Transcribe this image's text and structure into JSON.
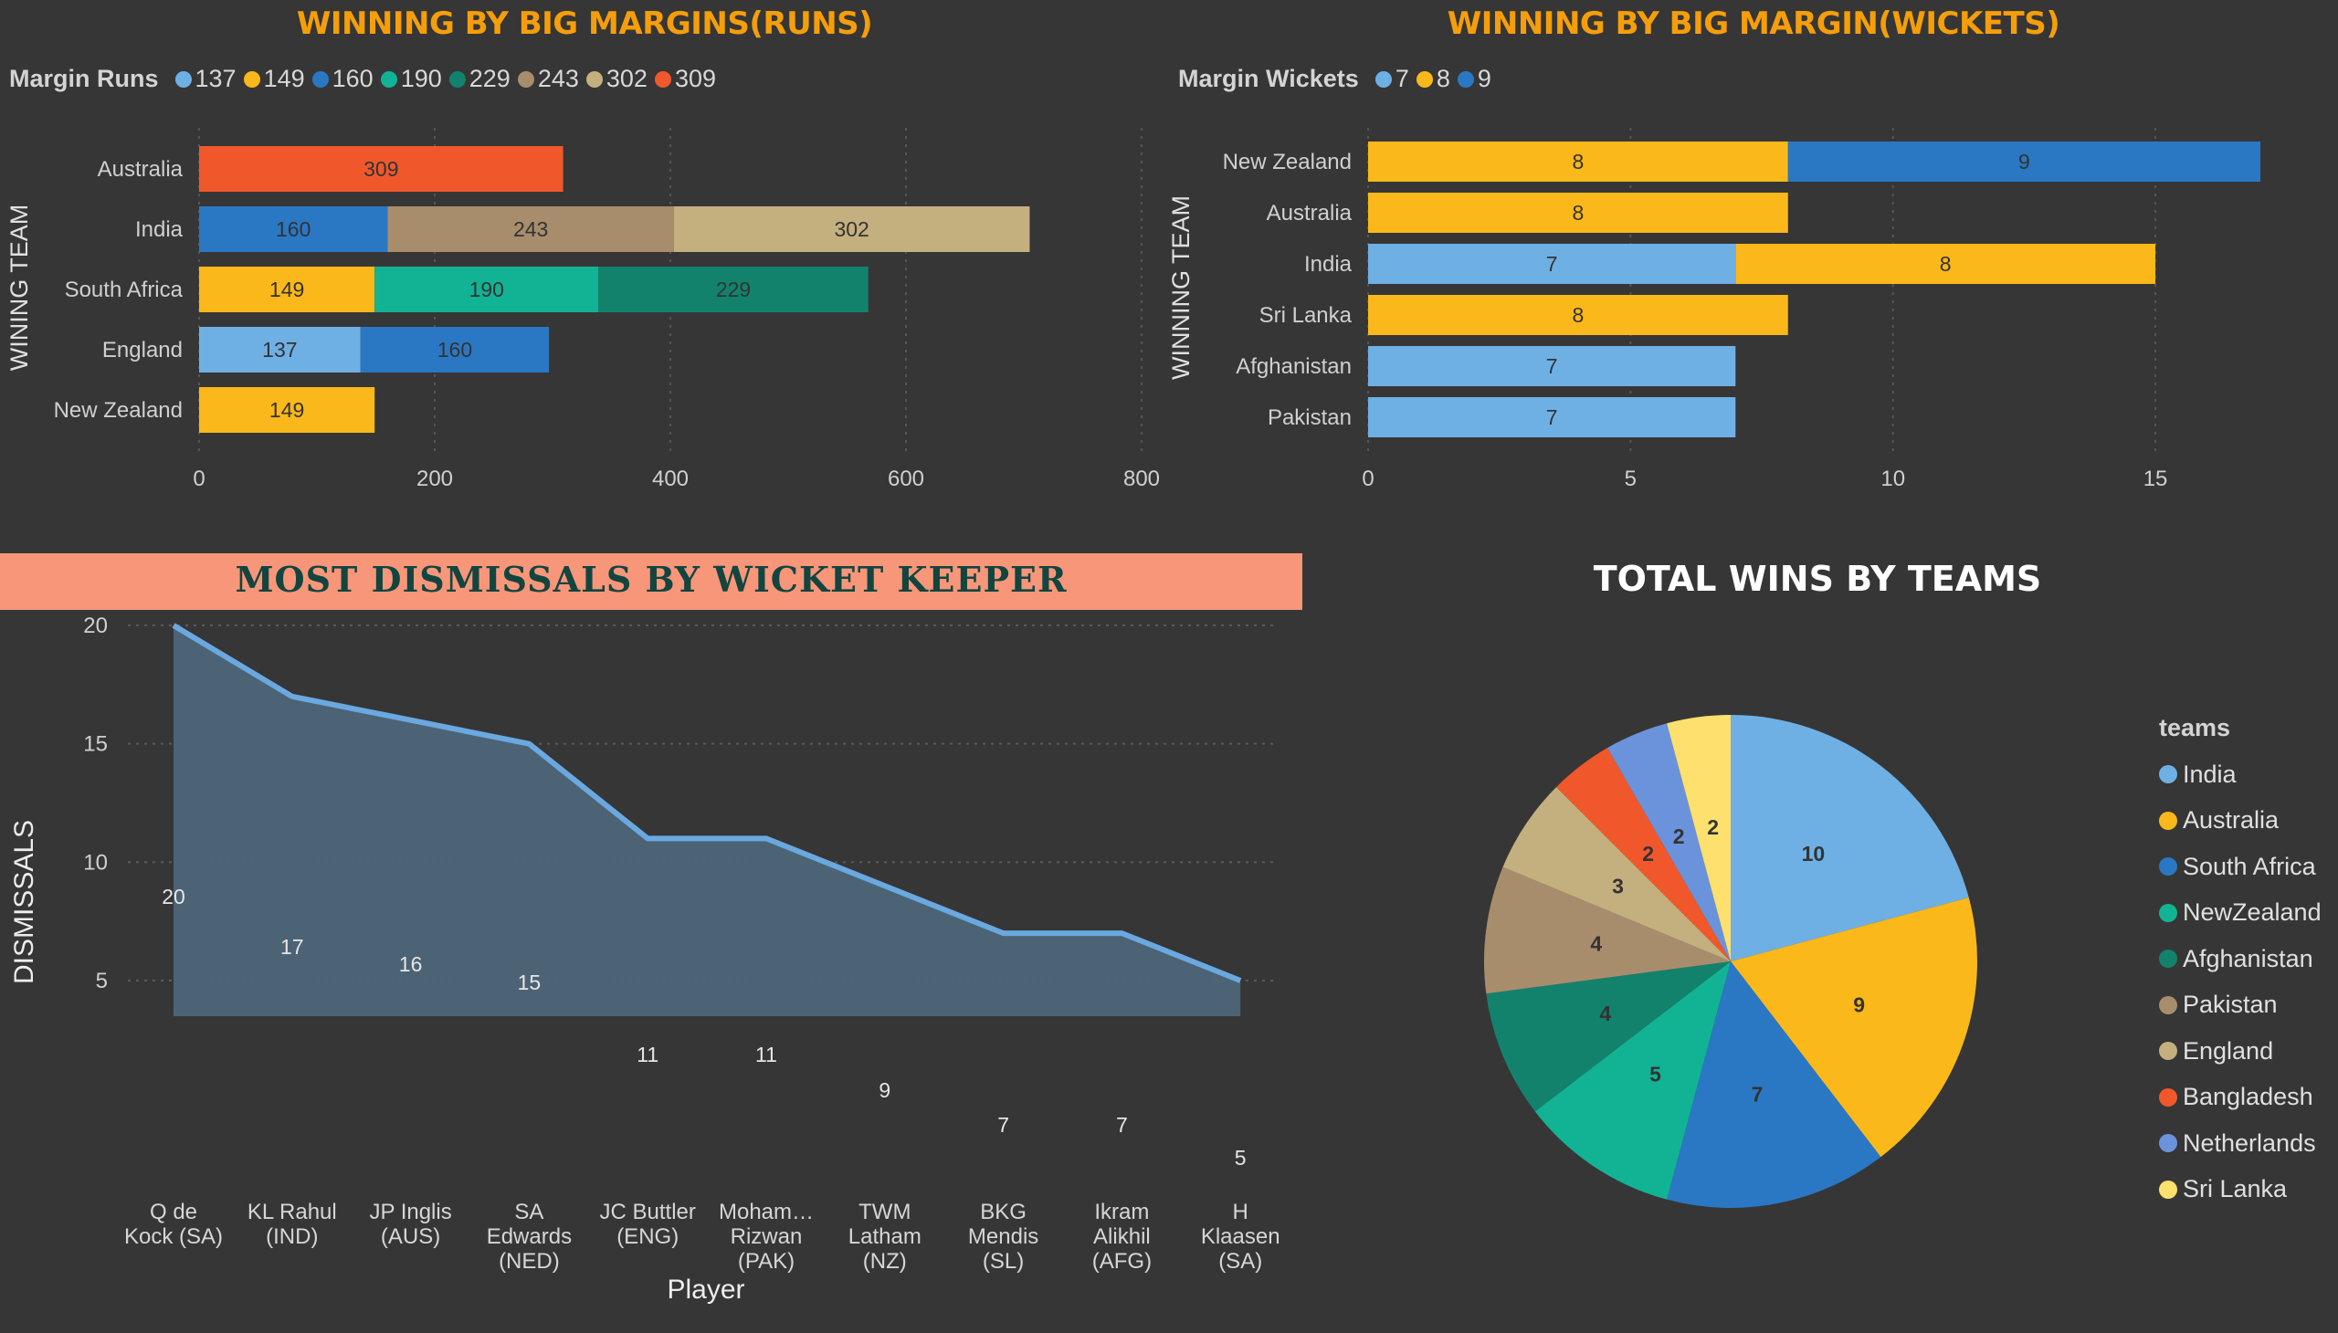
{
  "colors": {
    "background": "#363636",
    "title_orange": "#f59e0b",
    "wk_banner": "#f8967a",
    "wk_title": "#12453f",
    "area_line": "#6aa8e0",
    "area_fill": "#4e6679"
  },
  "runs_chart": {
    "title": "WINNING BY BIG MARGINS(RUNS)",
    "legend_title": "Margin Runs",
    "legend": [
      {
        "label": "137",
        "color": "#6eb0e4"
      },
      {
        "label": "149",
        "color": "#fbb81a"
      },
      {
        "label": "160",
        "color": "#2a78c3"
      },
      {
        "label": "190",
        "color": "#12b394"
      },
      {
        "label": "229",
        "color": "#12826d"
      },
      {
        "label": "243",
        "color": "#a88d6c"
      },
      {
        "label": "302",
        "color": "#c4b07f"
      },
      {
        "label": "309",
        "color": "#f0582c"
      }
    ],
    "y_axis_label": "WINING TEAM"
  },
  "wickets_chart": {
    "title": "WINNING BY BIG MARGIN(WICKETS)",
    "legend_title": "Margin Wickets",
    "legend": [
      {
        "label": "7",
        "color": "#6eb0e4"
      },
      {
        "label": "8",
        "color": "#fbb81a"
      },
      {
        "label": "9",
        "color": "#2a78c3"
      }
    ],
    "y_axis_label": "WINNING TEAM"
  },
  "wk_chart": {
    "title": "MOST DISMISSALS BY WICKET KEEPER",
    "x_axis_label": "Player",
    "y_axis_label": "DISMISSALS"
  },
  "pie_chart": {
    "title": "TOTAL WINS BY TEAMS",
    "legend_title": "teams"
  },
  "chart_data": [
    {
      "type": "bar",
      "stacked": true,
      "orientation": "horizontal",
      "title": "WINNING BY BIG MARGINS(RUNS)",
      "ylabel": "WINING TEAM",
      "xlim": [
        0,
        800
      ],
      "xticks": [
        0,
        200,
        400,
        600,
        800
      ],
      "grid": true,
      "legend_placement": "top-left",
      "categories": [
        "Australia",
        "India",
        "South Africa",
        "England",
        "New Zealand"
      ],
      "series": [
        {
          "name": "137",
          "values": [
            0,
            0,
            0,
            137,
            0
          ]
        },
        {
          "name": "149",
          "values": [
            0,
            0,
            149,
            0,
            149
          ]
        },
        {
          "name": "160",
          "values": [
            0,
            160,
            0,
            160,
            0
          ]
        },
        {
          "name": "190",
          "values": [
            0,
            0,
            190,
            0,
            0
          ]
        },
        {
          "name": "229",
          "values": [
            0,
            0,
            229,
            0,
            0
          ]
        },
        {
          "name": "243",
          "values": [
            0,
            243,
            0,
            0,
            0
          ]
        },
        {
          "name": "302",
          "values": [
            0,
            302,
            0,
            0,
            0
          ]
        },
        {
          "name": "309",
          "values": [
            309,
            0,
            0,
            0,
            0
          ]
        }
      ]
    },
    {
      "type": "bar",
      "stacked": true,
      "orientation": "horizontal",
      "title": "WINNING BY BIG MARGIN(WICKETS)",
      "ylabel": "WINNING TEAM",
      "xlim": [
        0,
        17
      ],
      "xticks": [
        0,
        5,
        10,
        15
      ],
      "grid": true,
      "legend_placement": "top-left",
      "categories": [
        "New Zealand",
        "Australia",
        "India",
        "Sri Lanka",
        "Afghanistan",
        "Pakistan"
      ],
      "series": [
        {
          "name": "7",
          "values": [
            0,
            0,
            7,
            0,
            7,
            7
          ]
        },
        {
          "name": "8",
          "values": [
            8,
            8,
            8,
            8,
            0,
            0
          ]
        },
        {
          "name": "9",
          "values": [
            9,
            0,
            0,
            0,
            0,
            0
          ]
        }
      ]
    },
    {
      "type": "area",
      "title": "MOST DISMISSALS BY WICKET KEEPER",
      "xlabel": "Player",
      "ylabel": "DISMISSALS",
      "ylim": [
        4,
        20.5
      ],
      "yticks": [
        5,
        10,
        15,
        20
      ],
      "grid": true,
      "categories": [
        [
          "Q de",
          "Kock (SA)"
        ],
        [
          "KL Rahul",
          "(IND)"
        ],
        [
          "JP Inglis",
          "(AUS)"
        ],
        [
          "SA",
          "Edwards",
          "(NED)"
        ],
        [
          "JC Buttler",
          "(ENG)"
        ],
        [
          "Moham…",
          "Rizwan",
          "(PAK)"
        ],
        [
          "TWM",
          "Latham",
          "(NZ)"
        ],
        [
          "BKG",
          "Mendis",
          "(SL)"
        ],
        [
          "Ikram",
          "Alikhil",
          "(AFG)"
        ],
        [
          "H",
          "Klaasen",
          "(SA)"
        ]
      ],
      "values": [
        20,
        17,
        16,
        15,
        11,
        11,
        9,
        7,
        7,
        5
      ]
    },
    {
      "type": "pie",
      "title": "TOTAL WINS BY TEAMS",
      "legend_title": "teams",
      "legend_placement": "right",
      "slices": [
        {
          "label": "India",
          "value": 10,
          "color": "#6eb0e4"
        },
        {
          "label": "Australia",
          "value": 9,
          "color": "#fbb81a"
        },
        {
          "label": "South Africa",
          "value": 7,
          "color": "#2a78c3"
        },
        {
          "label": "NewZealand",
          "value": 5,
          "color": "#12b394"
        },
        {
          "label": "Afghanistan",
          "value": 4,
          "color": "#12826d"
        },
        {
          "label": "Pakistan",
          "value": 4,
          "color": "#a88d6c"
        },
        {
          "label": "England",
          "value": 3,
          "color": "#c4b07f"
        },
        {
          "label": "Bangladesh",
          "value": 2,
          "color": "#f0582c"
        },
        {
          "label": "Netherlands",
          "value": 2,
          "color": "#6b93dc"
        },
        {
          "label": "Sri Lanka",
          "value": 2,
          "color": "#fde06e"
        }
      ]
    }
  ]
}
